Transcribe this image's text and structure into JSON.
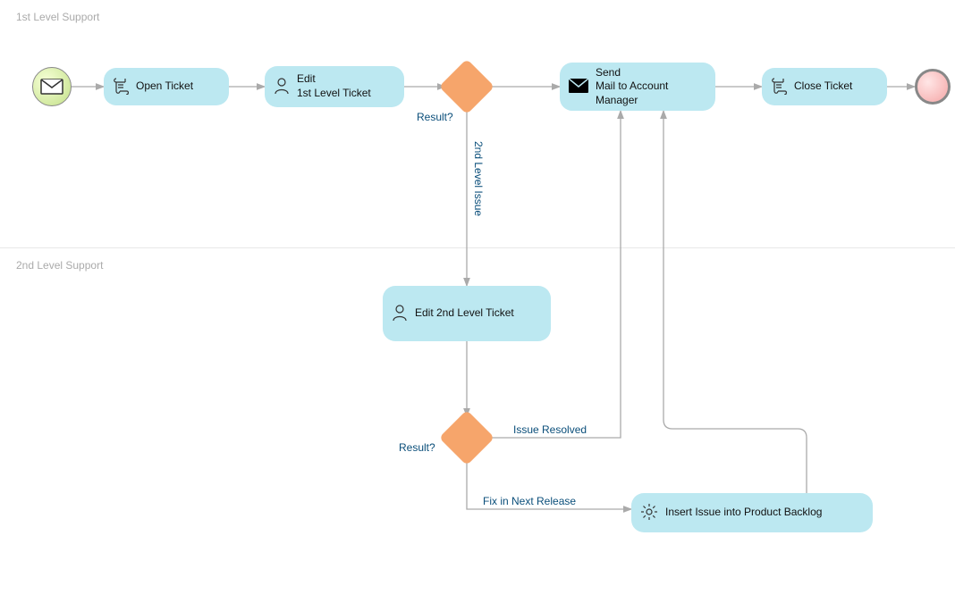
{
  "lanes": {
    "first": "1st Level Support",
    "second": "2nd Level Support"
  },
  "tasks": {
    "open_ticket": {
      "label": "Open Ticket"
    },
    "edit_first": {
      "label": "Edit\n1st Level Ticket"
    },
    "send_mail": {
      "label": "Send\nMail to Account\nManager"
    },
    "close_ticket": {
      "label": "Close Ticket"
    },
    "edit_second": {
      "label": "Edit 2nd Level Ticket"
    },
    "insert_backlog": {
      "label": "Insert Issue into Product Backlog"
    }
  },
  "gateways": {
    "g1": {
      "label": "Result?"
    },
    "g2": {
      "label": "Result?"
    }
  },
  "edges": {
    "g1_down": "2nd Level Issue",
    "g2_right": "Issue Resolved",
    "g2_down": "Fix in Next Release"
  },
  "chart_data": {
    "type": "bpmn",
    "lanes": [
      {
        "id": "L1",
        "name": "1st Level Support"
      },
      {
        "id": "L2",
        "name": "2nd Level Support"
      }
    ],
    "events": [
      {
        "id": "start",
        "type": "startMessage",
        "lane": "L1"
      },
      {
        "id": "end",
        "type": "end",
        "lane": "L1"
      }
    ],
    "tasks": [
      {
        "id": "t_open",
        "name": "Open Ticket",
        "type": "scriptTask",
        "lane": "L1"
      },
      {
        "id": "t_edit1",
        "name": "Edit 1st Level Ticket",
        "type": "userTask",
        "lane": "L1"
      },
      {
        "id": "t_mail",
        "name": "Send Mail to Account Manager",
        "type": "sendTask",
        "lane": "L1"
      },
      {
        "id": "t_close",
        "name": "Close Ticket",
        "type": "scriptTask",
        "lane": "L1"
      },
      {
        "id": "t_edit2",
        "name": "Edit 2nd Level Ticket",
        "type": "userTask",
        "lane": "L2"
      },
      {
        "id": "t_backlog",
        "name": "Insert Issue into Product Backlog",
        "type": "serviceTask",
        "lane": "L2"
      }
    ],
    "gateways": [
      {
        "id": "g1",
        "name": "Result?",
        "type": "exclusive",
        "lane": "L1"
      },
      {
        "id": "g2",
        "name": "Result?",
        "type": "exclusive",
        "lane": "L2"
      }
    ],
    "flows": [
      {
        "from": "start",
        "to": "t_open"
      },
      {
        "from": "t_open",
        "to": "t_edit1"
      },
      {
        "from": "t_edit1",
        "to": "g1"
      },
      {
        "from": "g1",
        "to": "t_mail"
      },
      {
        "from": "g1",
        "to": "t_edit2",
        "label": "2nd Level Issue"
      },
      {
        "from": "t_edit2",
        "to": "g2"
      },
      {
        "from": "g2",
        "to": "t_mail",
        "label": "Issue Resolved"
      },
      {
        "from": "g2",
        "to": "t_backlog",
        "label": "Fix in Next Release"
      },
      {
        "from": "t_backlog",
        "to": "t_mail"
      },
      {
        "from": "t_mail",
        "to": "t_close"
      },
      {
        "from": "t_close",
        "to": "end"
      }
    ]
  }
}
